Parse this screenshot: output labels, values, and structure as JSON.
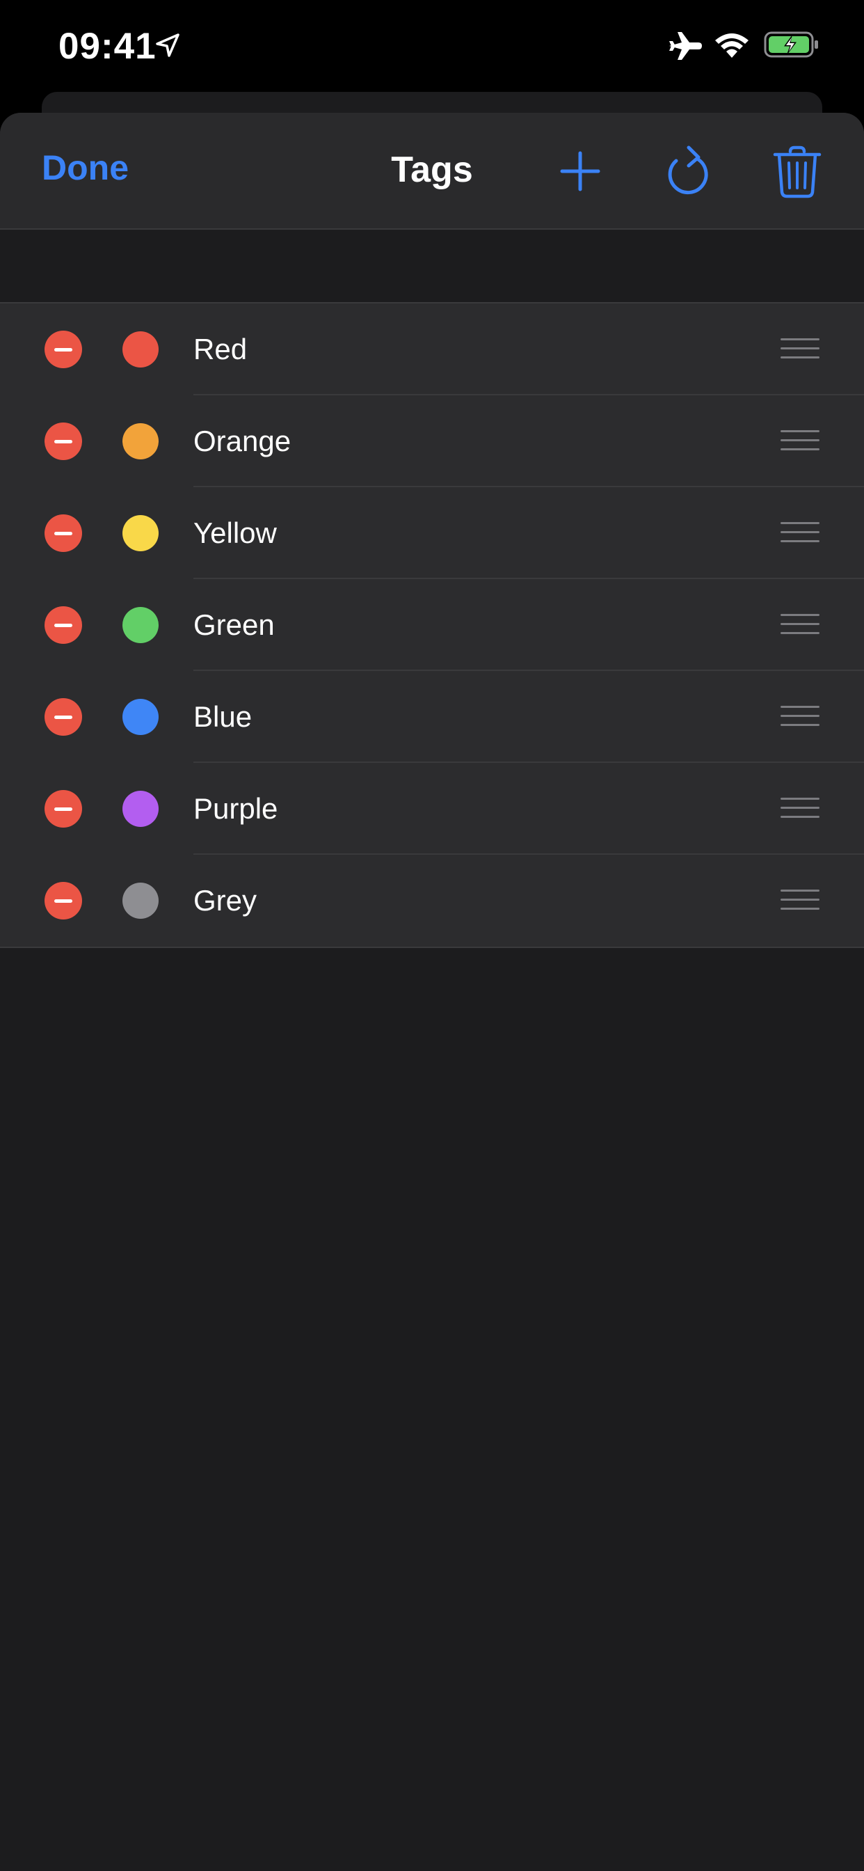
{
  "status_bar": {
    "time": "09:41",
    "icons": [
      "location-arrow-icon",
      "airplane-mode-icon",
      "wifi-icon",
      "battery-charging-icon"
    ]
  },
  "navbar": {
    "done_label": "Done",
    "title": "Tags",
    "icons": [
      "plus-icon",
      "refresh-icon",
      "trash-icon"
    ]
  },
  "colors": {
    "accent": "#3b82f6",
    "delete": "#eb5545",
    "background": "#1c1c1e",
    "row_background": "#2c2c2e"
  },
  "tags": [
    {
      "label": "Red",
      "color": "#eb5545"
    },
    {
      "label": "Orange",
      "color": "#f2a33a"
    },
    {
      "label": "Yellow",
      "color": "#f9d849"
    },
    {
      "label": "Green",
      "color": "#62cf67"
    },
    {
      "label": "Blue",
      "color": "#3f86f6"
    },
    {
      "label": "Purple",
      "color": "#b35ef0"
    },
    {
      "label": "Grey",
      "color": "#8e8e92"
    }
  ]
}
